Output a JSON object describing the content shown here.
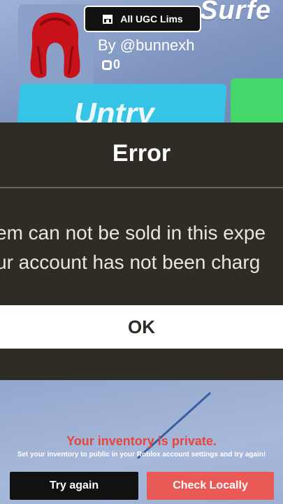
{
  "header": {
    "ugc_button_label": "All UGC Lims",
    "store_icon": "store-icon"
  },
  "item": {
    "title_partial": "Surfe",
    "creator": "By @bunnexh",
    "price": "0",
    "buy_label_partial": "Untry"
  },
  "error_dialog": {
    "title": "Error",
    "message_line1": "em can not be sold in this expe",
    "message_line2": "ur account has not been charg",
    "ok_label": "OK"
  },
  "inventory_notice": {
    "title": "Your inventory is private.",
    "subtitle": "Set your inventory to public in your Roblox account settings and try again!"
  },
  "footer": {
    "try_again_label": "Try again",
    "check_locally_label": "Check Locally"
  },
  "colors": {
    "modal_bg": "#2f2b25",
    "accent_red": "#e8453c",
    "check_button": "#e95a57",
    "cyan_button": "#35c3e6",
    "green_button": "#44d86a"
  }
}
